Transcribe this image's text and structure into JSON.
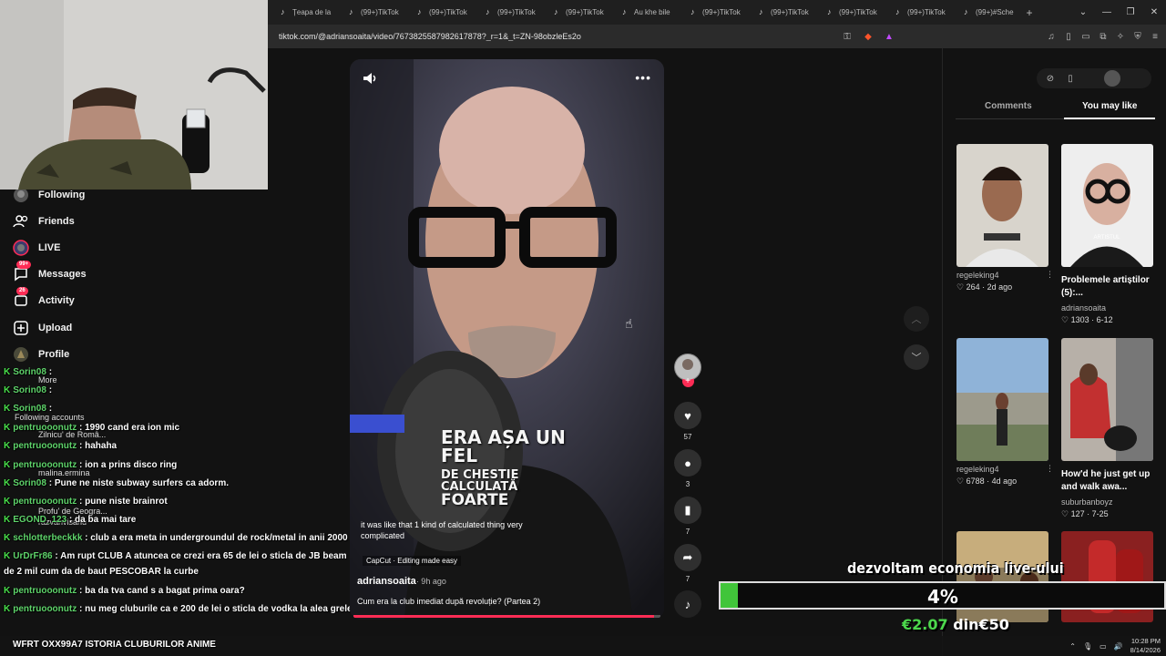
{
  "browser": {
    "tabs": [
      "Țeapa de la",
      "(99+)TikTok",
      "(99+)TikTok",
      "(99+)TikTok",
      "(99+)TikTok",
      "Au khe bile",
      "(99+)TikTok",
      "(99+)TikTok",
      "(99+)TikTok",
      "(99+)TikTok",
      "(99+)#Sche"
    ],
    "new_tab": "+",
    "url": "tiktok.com/@adriansoaita/video/7673825587982617878?_r=1&_t=ZN-98obzleEs2o"
  },
  "sidebar": {
    "items": [
      {
        "label": "Following",
        "icon": "following-icon"
      },
      {
        "label": "Friends",
        "icon": "friends-icon"
      },
      {
        "label": "LIVE",
        "icon": "live-icon"
      },
      {
        "label": "Messages",
        "icon": "messages-icon",
        "badge": "99+"
      },
      {
        "label": "Activity",
        "icon": "activity-icon",
        "badge": "26"
      },
      {
        "label": "Upload",
        "icon": "upload-icon"
      },
      {
        "label": "Profile",
        "icon": "profile-icon"
      }
    ],
    "more": "More",
    "following_accounts": "Following accounts",
    "accounts": [
      "Zilnicu' de Româ...",
      "malina.ermina",
      "Profu' de Geogra...",
      "razvanvisanu"
    ]
  },
  "chat": [
    {
      "user": "Sorin08",
      "msg": ""
    },
    {
      "user": "Sorin08",
      "msg": ""
    },
    {
      "user": "Sorin08",
      "msg": ""
    },
    {
      "user": "pentruooonutz",
      "msg": "1990 cand era ion mic"
    },
    {
      "user": "pentruooonutz",
      "msg": "hahaha"
    },
    {
      "user": "pentruooonutz",
      "msg": "ion a prins disco ring"
    },
    {
      "user": "Sorin08",
      "msg": "Pune ne niste subway surfers ca adorm."
    },
    {
      "user": "pentruooonutz",
      "msg": "pune niste brainrot"
    },
    {
      "user": "EGOND_123",
      "msg": "da ba mai tare"
    },
    {
      "user": "schlotterbeckkk",
      "msg": "club a era meta in undergroundul de rock/metal in anii 2000"
    },
    {
      "user": "UrDrFr86",
      "msg": "Am rupt CLUB A atuncea ce crezi era 65 de lei o sticla de JB beam"
    },
    {
      "user": "",
      "msg": "de 2 mil cum da de baut PESCOBAR la curbe"
    },
    {
      "user": "pentruooonutz",
      "msg": "ba da tva cand s a bagat prima oara?"
    },
    {
      "user": "pentruooonutz",
      "msg": "nu meg cluburile ca e 200 de lei o sticla de vodka la alea grele"
    }
  ],
  "bottom_message": "WFRT OXX99A7 ISTORIA CLUBURILOR ANIME",
  "video": {
    "overlay_line1": "ERA AȘA UN FEL",
    "overlay_line2": "DE CHESTIE CALCULATĂ",
    "overlay_line3": "FOARTE",
    "subtitle": "it was like that 1 kind of calculated thing very complicated",
    "capcut": "CapCut · Editing made easy",
    "author": "adriansoaita",
    "posted": "· 9h ago",
    "description": "Cum era la club imediat după revoluție? (Partea 2)",
    "progress": 0.98
  },
  "actions": {
    "likes": "57",
    "comments": "3",
    "saves": "7",
    "shares": "7"
  },
  "right_panel": {
    "tabs": [
      "Comments",
      "You may like"
    ],
    "cards": [
      {
        "title": "",
        "user": "regeleking4",
        "likes": "264",
        "time": "2d ago"
      },
      {
        "title": "Problemele artiștilor (5):...",
        "user": "adriansoaita",
        "likes": "1303",
        "time": "6-12"
      },
      {
        "title": "",
        "user": "regeleking4",
        "likes": "6788",
        "time": "4d ago"
      },
      {
        "title": "How'd he just get up and walk awa...",
        "user": "suburbanboyz",
        "likes": "127",
        "time": "7-25"
      }
    ],
    "thumb2_text": "ARTISTUL"
  },
  "economy": {
    "title": "dezvoltam economia live-ului",
    "percent_label": "4%",
    "percent": 0.04,
    "current": "€2.07",
    "din": "din",
    "goal": "€50"
  },
  "taskbar": {
    "time": "10:28 PM",
    "date": "8/14/2026"
  },
  "colors": {
    "accent": "#fe2c55",
    "econ_green": "#41c53a"
  }
}
